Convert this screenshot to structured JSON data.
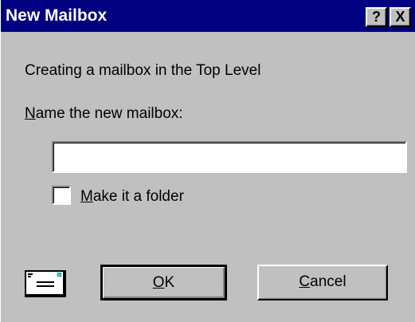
{
  "window": {
    "title": "New Mailbox",
    "help_label": "?",
    "close_label": "X"
  },
  "content": {
    "info_text": "Creating a mailbox in the Top Level",
    "name_label_mnemonic": "N",
    "name_label_rest": "ame the new mailbox:",
    "name_input_value": "",
    "folder_checkbox": {
      "checked": false,
      "label_mnemonic": "M",
      "label_rest": "ake it a folder"
    }
  },
  "buttons": {
    "ok_mnemonic": "O",
    "ok_rest": "K",
    "cancel_mnemonic": "C",
    "cancel_rest": "ancel"
  },
  "icons": {
    "mailbox": "mail-envelope-icon"
  },
  "colors": {
    "titlebar": "#000080",
    "dialog_face": "#c0c0c0"
  }
}
